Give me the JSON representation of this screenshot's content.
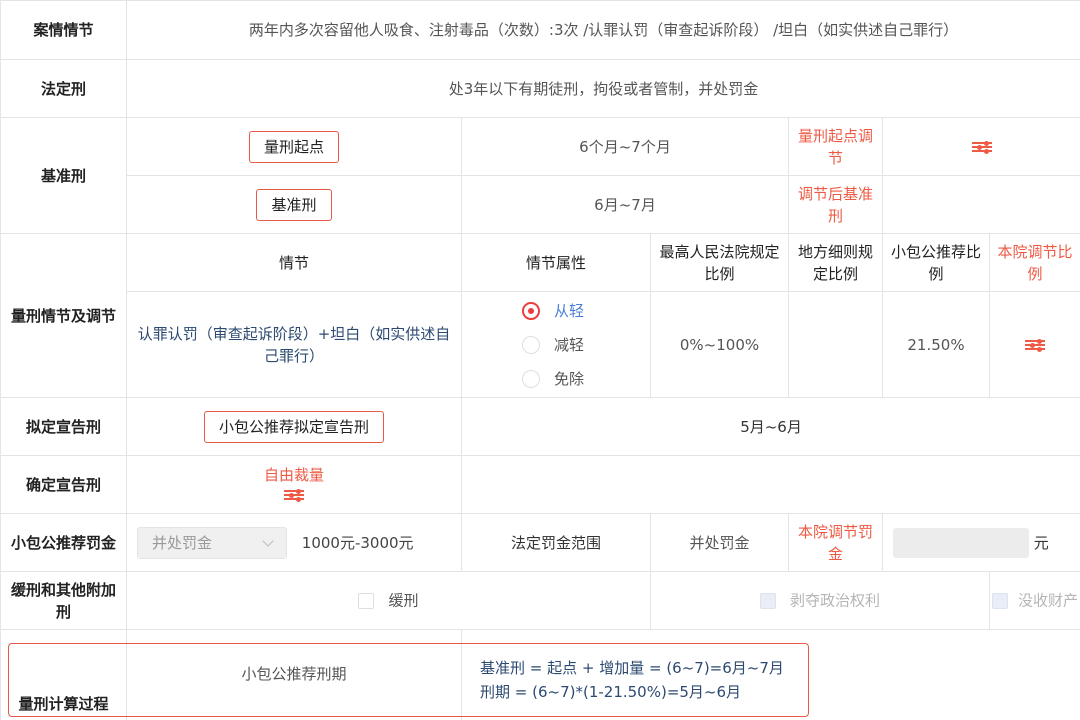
{
  "case_facts": {
    "label": "案情情节",
    "value": "两年内多次容留他人吸食、注射毒品（次数）:3次 /认罪认罚（审查起诉阶段） /坦白（如实供述自己罪行）"
  },
  "statutory_penalty": {
    "label": "法定刑",
    "value": "处3年以下有期徒刑，拘役或者管制，并处罚金"
  },
  "base_penalty": {
    "label": "基准刑",
    "start_button": "量刑起点",
    "start_range": "6个月~7个月",
    "start_adjust_label": "量刑起点调节",
    "base_button": "基准刑",
    "base_range": "6月~7月",
    "adjusted_label": "调节后基准刑"
  },
  "circumstances": {
    "label": "量刑情节及调节",
    "headers": {
      "circumstance": "情节",
      "attribute": "情节属性",
      "spc_ratio": "最高人民法院规定比例",
      "local_ratio": "地方细则规定比例",
      "recommended_ratio": "小包公推荐比例",
      "court_ratio": "本院调节比例"
    },
    "row": {
      "circumstance": "认罪认罚（审查起诉阶段）+坦白（如实供述自己罪行）",
      "options": [
        {
          "label": "从轻",
          "selected": true
        },
        {
          "label": "减轻",
          "selected": false
        },
        {
          "label": "免除",
          "selected": false
        }
      ],
      "spc_ratio": "0%~100%",
      "local_ratio": "",
      "recommended_ratio": "21.50%"
    }
  },
  "proposed_sentence": {
    "label": "拟定宣告刑",
    "button": "小包公推荐拟定宣告刑",
    "value": "5月~6月"
  },
  "confirmed_sentence": {
    "label": "确定宣告刑",
    "discretion_label": "自由裁量"
  },
  "fine": {
    "label": "小包公推荐罚金",
    "select_value": "并处罚金",
    "range": "1000元-3000元",
    "statutory_range_label": "法定罚金范围",
    "statutory_value": "并处罚金",
    "court_fine_label": "本院调节罚金",
    "unit": "元"
  },
  "probation": {
    "label": "缓刑和其他附加刑",
    "options": [
      {
        "label": "缓刑",
        "disabled": false
      },
      {
        "label": "剥夺政治权利",
        "disabled": true
      },
      {
        "label": "没收财产",
        "disabled": true
      }
    ]
  },
  "calculation": {
    "label": "量刑计算过程",
    "sub_label": "小包公推荐刑期",
    "line1": "基准刑 = 起点 + 增加量 = (6~7)=6月~7月",
    "line2": "刑期 = (6~7)*(1-21.50%)=5月~6月"
  },
  "colors": {
    "accent_red": "#ee5a44",
    "radio_red": "#ee3b3b",
    "selected_blue": "#4a7fd6",
    "border": "#e2e4e8"
  },
  "icons": {
    "adjust": "sliders-adjust-icon",
    "dropdown": "chevron-down-icon"
  }
}
